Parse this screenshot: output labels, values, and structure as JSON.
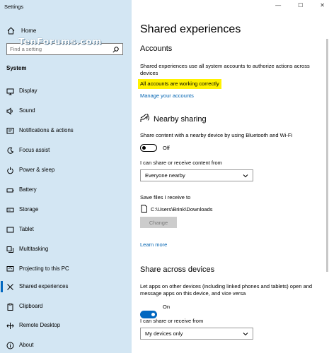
{
  "window": {
    "title": "Settings",
    "controls": {
      "minimize": "—",
      "maximize": "☐",
      "close": "✕"
    }
  },
  "sidebar": {
    "home_label": "Home",
    "search_placeholder": "Find a setting",
    "watermark": "TenForums.com",
    "section_label": "System",
    "items": [
      {
        "label": "Display",
        "icon": "display-icon"
      },
      {
        "label": "Sound",
        "icon": "sound-icon"
      },
      {
        "label": "Notifications & actions",
        "icon": "notifications-icon"
      },
      {
        "label": "Focus assist",
        "icon": "focus-assist-icon"
      },
      {
        "label": "Power & sleep",
        "icon": "power-icon"
      },
      {
        "label": "Battery",
        "icon": "battery-icon"
      },
      {
        "label": "Storage",
        "icon": "storage-icon"
      },
      {
        "label": "Tablet",
        "icon": "tablet-icon"
      },
      {
        "label": "Multitasking",
        "icon": "multitasking-icon"
      },
      {
        "label": "Projecting to this PC",
        "icon": "projecting-icon"
      },
      {
        "label": "Shared experiences",
        "icon": "shared-experiences-icon",
        "active": true
      },
      {
        "label": "Clipboard",
        "icon": "clipboard-icon"
      },
      {
        "label": "Remote Desktop",
        "icon": "remote-desktop-icon"
      },
      {
        "label": "About",
        "icon": "about-icon"
      }
    ]
  },
  "main": {
    "page_title": "Shared experiences",
    "accounts": {
      "heading": "Accounts",
      "description": "Shared experiences use all system accounts to authorize actions across devices",
      "status": "All accounts are working correctly",
      "status_highlight_color": "#fff200",
      "manage_link": "Manage your accounts"
    },
    "nearby": {
      "heading": "Nearby sharing",
      "description": "Share content with a nearby device by using Bluetooth and Wi-Fi",
      "toggle_state": "Off",
      "share_from_label": "I can share or receive content from",
      "share_from_value": "Everyone nearby",
      "save_files_label": "Save files I receive to",
      "save_path": "C:\\Users\\Brink\\Downloads",
      "change_button": "Change",
      "learn_more": "Learn more"
    },
    "across": {
      "heading": "Share across devices",
      "description": "Let apps on other devices (including linked phones and tablets) open and message apps on this device, and vice versa",
      "toggle_state": "On",
      "share_from_label": "I can share or receive from",
      "share_from_value": "My devices only"
    }
  },
  "colors": {
    "sidebar_bg": "#d3e6f3",
    "accent": "#0067c0",
    "link": "#0063b1"
  }
}
